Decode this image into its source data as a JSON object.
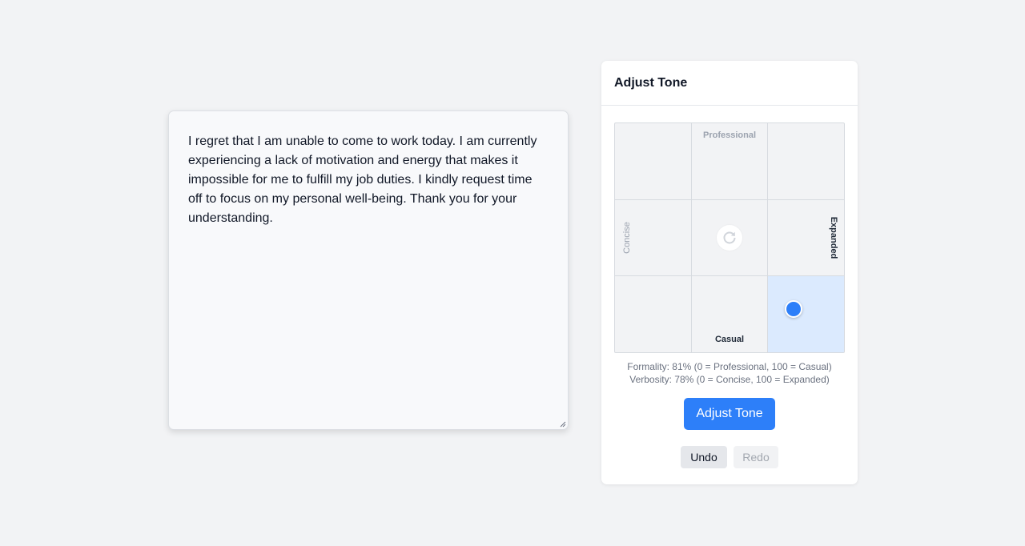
{
  "editor": {
    "text": "I regret that I am unable to come to work today. I am currently experiencing a lack of motivation and energy that makes it impossible for me to fulfill my job duties. I kindly request time off to focus on my personal well-being. Thank you for your understanding."
  },
  "panel": {
    "title": "Adjust Tone",
    "grid": {
      "top_label": "Professional",
      "bottom_label": "Casual",
      "left_label": "Concise",
      "right_label": "Expanded",
      "formality_percent": 81,
      "verbosity_percent": 78,
      "active_cell": "bottom-right"
    },
    "readout": {
      "formality": "Formality: 81% (0 = Professional, 100 = Casual)",
      "verbosity": "Verbosity: 78% (0 = Concise, 100 = Expanded)"
    },
    "adjust_button": "Adjust Tone",
    "undo_button": "Undo",
    "redo_button": "Redo"
  },
  "colors": {
    "accent": "#2d7ff9",
    "active_cell": "#dbeafe",
    "page_background": "#f2f3f5"
  }
}
